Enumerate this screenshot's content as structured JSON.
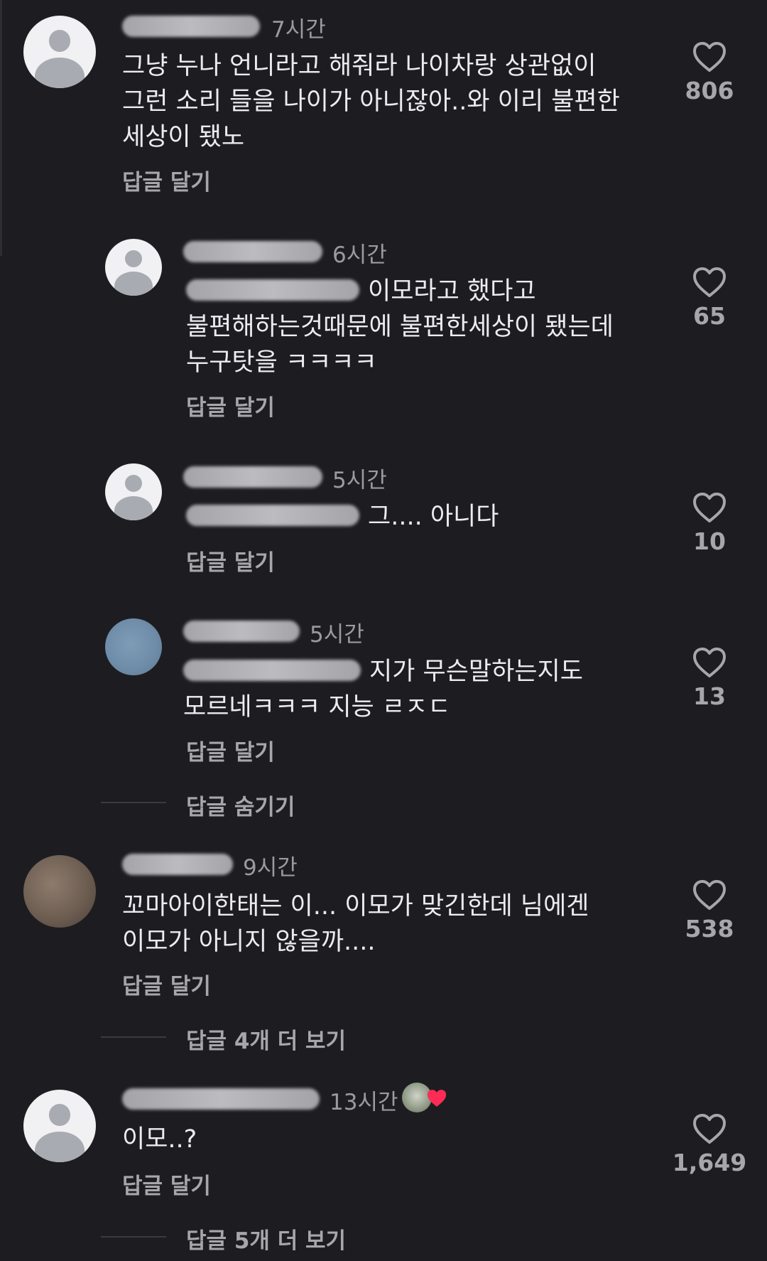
{
  "colors": {
    "background": "#1d1d21",
    "text_primary": "#ececee",
    "text_secondary": "#9a9aa0",
    "heart_red": "#fe2c55"
  },
  "comments": [
    {
      "time": "7시간",
      "text": "그냥 누나 언니라고 해줘라 나이차랑 상관없이\n그런 소리 들을 나이가 아니잖아..와 이리 불편한\n세상이 됐노",
      "reply_label": "답글 달기",
      "likes": "806",
      "avatar_icon": "default-avatar-icon"
    },
    {
      "time": "6시간",
      "text": "이모라고 했다고\n불편해하는것때문에 불편한세상이 됐는데\n누구탓을 ㅋㅋㅋㅋ",
      "reply_label": "답글 달기",
      "likes": "65",
      "avatar_icon": "default-avatar-icon"
    },
    {
      "time": "5시간",
      "text": "그.... 아니다",
      "reply_label": "답글 달기",
      "likes": "10",
      "avatar_icon": "default-avatar-icon"
    },
    {
      "time": "5시간",
      "text": "지가 무슨말하는지도\n모르네ㅋㅋㅋ 지능 ㄹㅈㄷ",
      "reply_label": "답글 달기",
      "likes": "13",
      "avatar_icon": "photo-avatar-icon"
    },
    {
      "time": "9시간",
      "text": "꼬마아이한태는 이... 이모가 맞긴한데 님에겐\n이모가 아니지 않을까....",
      "reply_label": "답글 달기",
      "likes": "538",
      "avatar_icon": "photo-avatar-icon"
    },
    {
      "time": "13시간",
      "text": "이모..?",
      "reply_label": "답글 달기",
      "likes": "1,649",
      "avatar_icon": "default-avatar-icon",
      "creator_liked_icon": "creator-liked-heart-icon"
    }
  ],
  "thread_links": {
    "hide_replies": "답글 숨기기",
    "more_replies_4": "답글 4개 더 보기",
    "more_replies_5": "답글 5개 더 보기"
  },
  "icons": {
    "like": "heart-outline-icon"
  }
}
